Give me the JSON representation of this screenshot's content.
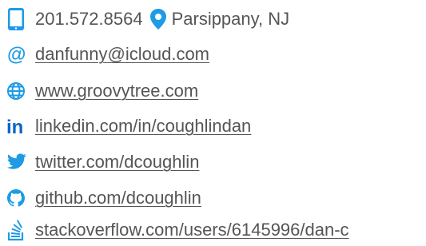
{
  "colors": {
    "accent": "#1e9be4",
    "linkedin": "#0a66c2",
    "twitter": "#1e9be4",
    "text": "#555555"
  },
  "contact": {
    "phone": {
      "icon": "phone-icon",
      "value": "201.572.8564"
    },
    "location": {
      "icon": "location-pin-icon",
      "value": "Parsippany, NJ"
    },
    "email": {
      "icon": "at-sign-icon",
      "value": "danfunny@icloud.com"
    },
    "website": {
      "icon": "globe-icon",
      "value": "www.groovytree.com"
    },
    "linkedin": {
      "icon": "linkedin-icon",
      "value": "linkedin.com/in/coughlindan"
    },
    "twitter": {
      "icon": "twitter-icon",
      "value": "twitter.com/dcoughlin"
    },
    "github": {
      "icon": "github-icon",
      "value": "github.com/dcoughlin"
    },
    "stackoverflow": {
      "icon": "stackoverflow-icon",
      "value": "stackoverflow.com/users/6145996/dan-c"
    }
  }
}
